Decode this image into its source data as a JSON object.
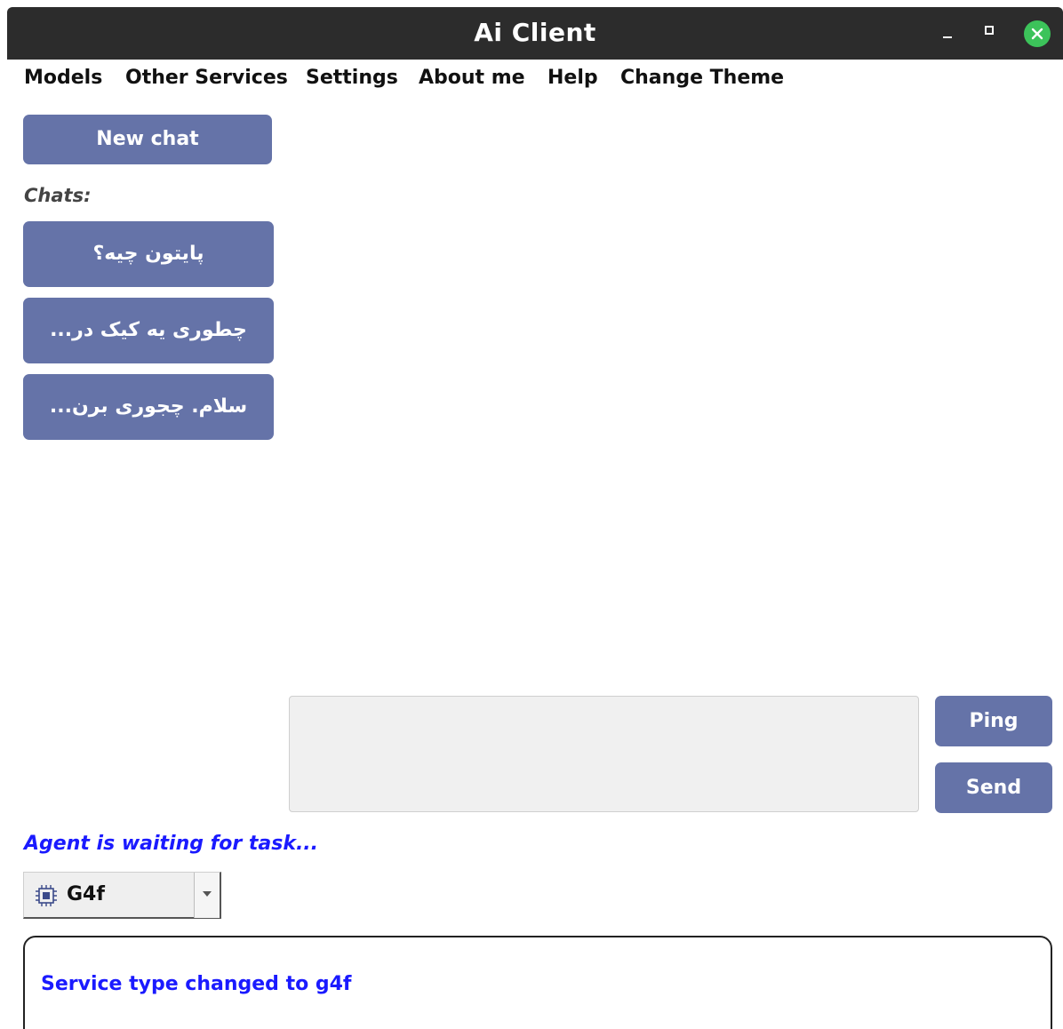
{
  "window": {
    "title": "Ai Client"
  },
  "menu": {
    "items": [
      "Models",
      "Other Services",
      "Settings",
      "About me",
      "Help",
      "Change Theme"
    ]
  },
  "sidebar": {
    "new_chat_label": "New chat",
    "chats_label": "Chats:",
    "chats": [
      "پایتون چیه؟",
      "...چطوری یه کیک در",
      "...سلام. چجوری برن"
    ]
  },
  "composer": {
    "input_value": "",
    "ping_label": "Ping",
    "send_label": "Send"
  },
  "status": {
    "text": "Agent is waiting for task..."
  },
  "service_select": {
    "selected": "G4f",
    "icon": "chip-icon"
  },
  "log": {
    "text": "Service type changed to g4f"
  },
  "colors": {
    "titlebar": "#2c2c2c",
    "button": "#6573a8",
    "status_text": "#1a1aff",
    "close_button": "#3cc35a"
  }
}
